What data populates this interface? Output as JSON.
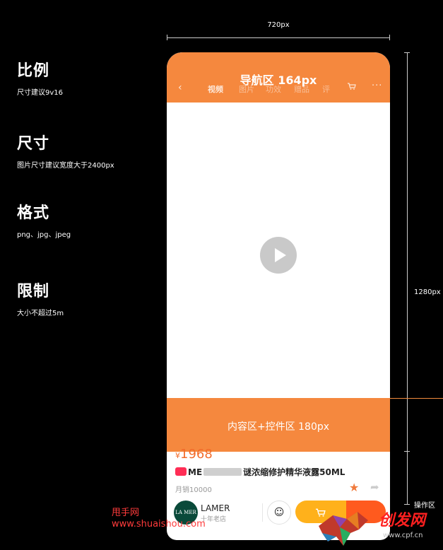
{
  "left": {
    "ratio_title": "比例",
    "ratio_sub": "尺寸建议9v16",
    "size_title": "尺寸",
    "size_sub": "图片尺寸建议宽度大于2400px",
    "format_title": "格式",
    "format_sub": "png、jpg、jpeg",
    "limit_title": "限制",
    "limit_sub": "大小不超过5m"
  },
  "dimensions": {
    "width_label": "720px",
    "height_label": "1280px",
    "ops_label": "操作区"
  },
  "nav": {
    "zone_label": "导航区 164px",
    "back": "‹",
    "tabs": [
      "视频",
      "图片",
      "功效",
      "赠品",
      "评"
    ],
    "more": "···"
  },
  "content_zone_label": "内容区+控件区 180px",
  "product": {
    "price_symbol": "¥",
    "price": "1968",
    "title_prefix": "ME",
    "title_suffix": "谜浓缩修护精华液露50ML",
    "sales": "月销10000"
  },
  "store": {
    "logo_text": "LA MER",
    "name": "LAMER",
    "sub": "十年老店"
  },
  "watermark": {
    "left1": "甩手网",
    "left2": "www.shuaishou.com",
    "right1": "创发网",
    "right2": "www.cpf.cn"
  },
  "colors": {
    "accent": "#f5883e",
    "price": "#f26c2b",
    "cart": "#ffb11b",
    "buy": "#ff5a1e"
  }
}
